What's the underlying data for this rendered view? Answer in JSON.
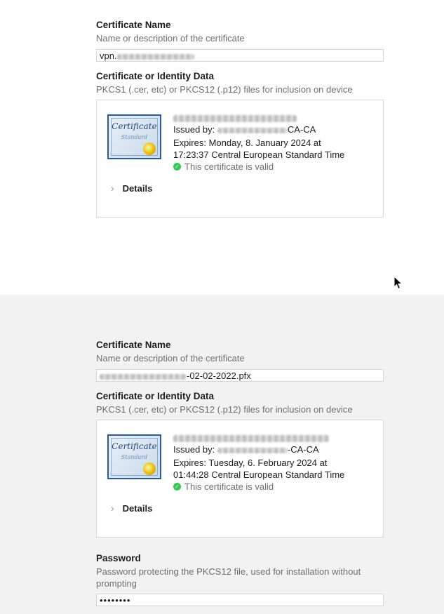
{
  "top": {
    "cert_name_title": "Certificate Name",
    "cert_name_desc": "Name or description of the certificate",
    "cert_name_value_prefix": "vpn.",
    "identity_title": "Certificate or Identity Data",
    "identity_desc": "PKCS1 (.cer, etc) or PKCS12 (.p12) files for inclusion on device",
    "certificate": {
      "image_text": "Certificate",
      "image_subtext": "Standard",
      "issued_by_label": "Issued by:",
      "issued_by_suffix": "CA-CA",
      "expires_line1": "Expires: Monday, 8. January 2024 at",
      "expires_line2": "17:23:37 Central European Standard Time",
      "valid_text": "This certificate is valid",
      "details_label": "Details"
    }
  },
  "bottom": {
    "cert_name_title": "Certificate Name",
    "cert_name_desc": "Name or description of the certificate",
    "cert_name_value_suffix": "-02-02-2022.pfx",
    "identity_title": "Certificate or Identity Data",
    "identity_desc": "PKCS1 (.cer, etc) or PKCS12 (.p12) files for inclusion on device",
    "certificate": {
      "image_text": "Certificate",
      "image_subtext": "Standard",
      "issued_by_label": "Issued by:",
      "issued_by_suffix": "-CA-CA",
      "expires_line1": "Expires: Tuesday, 6. February 2024 at",
      "expires_line2": "01:44:28 Central European Standard Time",
      "valid_text": "This certificate is valid",
      "details_label": "Details"
    },
    "password_title": "Password",
    "password_desc": "Password protecting the PKCS12 file, used for installation without prompting",
    "password_value": "••••••••"
  },
  "icons": {
    "valid": "checkmark-circle-icon",
    "details": "chevron-right-icon",
    "cursor": "mouse-pointer-icon"
  },
  "colors": {
    "valid_green": "#34c759",
    "cert_border_blue": "#2c5a93",
    "bottom_panel_bg": "#f2f2f2"
  }
}
